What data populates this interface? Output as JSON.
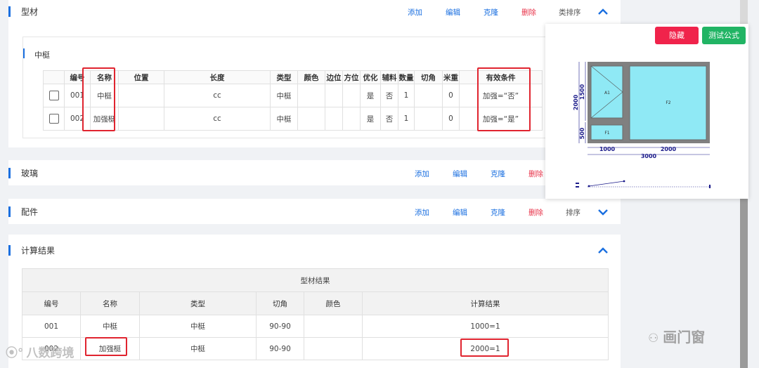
{
  "sections": {
    "profile": {
      "title": "型材",
      "actions": {
        "add": "添加",
        "edit": "编辑",
        "clone": "克隆",
        "delete": "删除",
        "sort": "类排序"
      }
    },
    "mullion": {
      "title": "中梃",
      "columns": [
        "",
        "编号",
        "名称",
        "位置",
        "长度",
        "类型",
        "颜色",
        "边位",
        "方位",
        "优化",
        "辅料",
        "数量",
        "切角",
        "米重",
        "有效条件"
      ],
      "rows": [
        {
          "code": "001",
          "name": "中梃",
          "position": "",
          "length": "cc",
          "type": "中梃",
          "color": "",
          "edge": "",
          "orient": "",
          "optimize": "是",
          "aux": "否",
          "qty": "1",
          "cut": "",
          "weight": "0",
          "condition": "加强=“否”"
        },
        {
          "code": "002",
          "name": "加强梃",
          "position": "",
          "length": "cc",
          "type": "中梃",
          "color": "",
          "edge": "",
          "orient": "",
          "optimize": "是",
          "aux": "否",
          "qty": "1",
          "cut": "",
          "weight": "0",
          "condition": "加强=“是”"
        }
      ]
    },
    "glass": {
      "title": "玻璃",
      "actions": {
        "add": "添加",
        "edit": "编辑",
        "clone": "克隆",
        "delete": "删除"
      }
    },
    "parts": {
      "title": "配件",
      "actions": {
        "add": "添加",
        "edit": "编辑",
        "clone": "克隆",
        "delete": "删除",
        "sort": "排序"
      }
    },
    "results": {
      "title": "计算结果",
      "table_caption": "型材结果",
      "columns": [
        "编号",
        "名称",
        "类型",
        "切角",
        "颜色",
        "计算结果"
      ],
      "rows": [
        {
          "code": "001",
          "name": "中梃",
          "type": "中梃",
          "cut": "90-90",
          "color": "",
          "result": "1000=1"
        },
        {
          "code": "002",
          "name": "加强梃",
          "type": "中梃",
          "cut": "90-90",
          "color": "",
          "result": "2000=1"
        }
      ]
    }
  },
  "preview": {
    "hide_button": "隐藏",
    "test_button": "测试公式",
    "hide_color": "#f0234b",
    "test_color": "#21b464",
    "drawing": {
      "pane_labels": {
        "a1": "A1",
        "f2": "F2",
        "f1": "F1"
      },
      "dims": {
        "height_total": "2000",
        "height_top": "1500",
        "height_bottom": "500",
        "width_left": "1000",
        "width_right": "2000",
        "width_total": "3000"
      },
      "glass_color": "#8fe9f5",
      "frame_color": "#808080"
    }
  },
  "watermark": {
    "left": "八数跨境",
    "right": "画门窗"
  },
  "colors": {
    "accent": "#1a6fe0",
    "danger": "#e8334a",
    "highlight": "#e0242f"
  },
  "icons": {
    "collapse": "chevron-up-icon",
    "expand": "chevron-down-icon"
  }
}
